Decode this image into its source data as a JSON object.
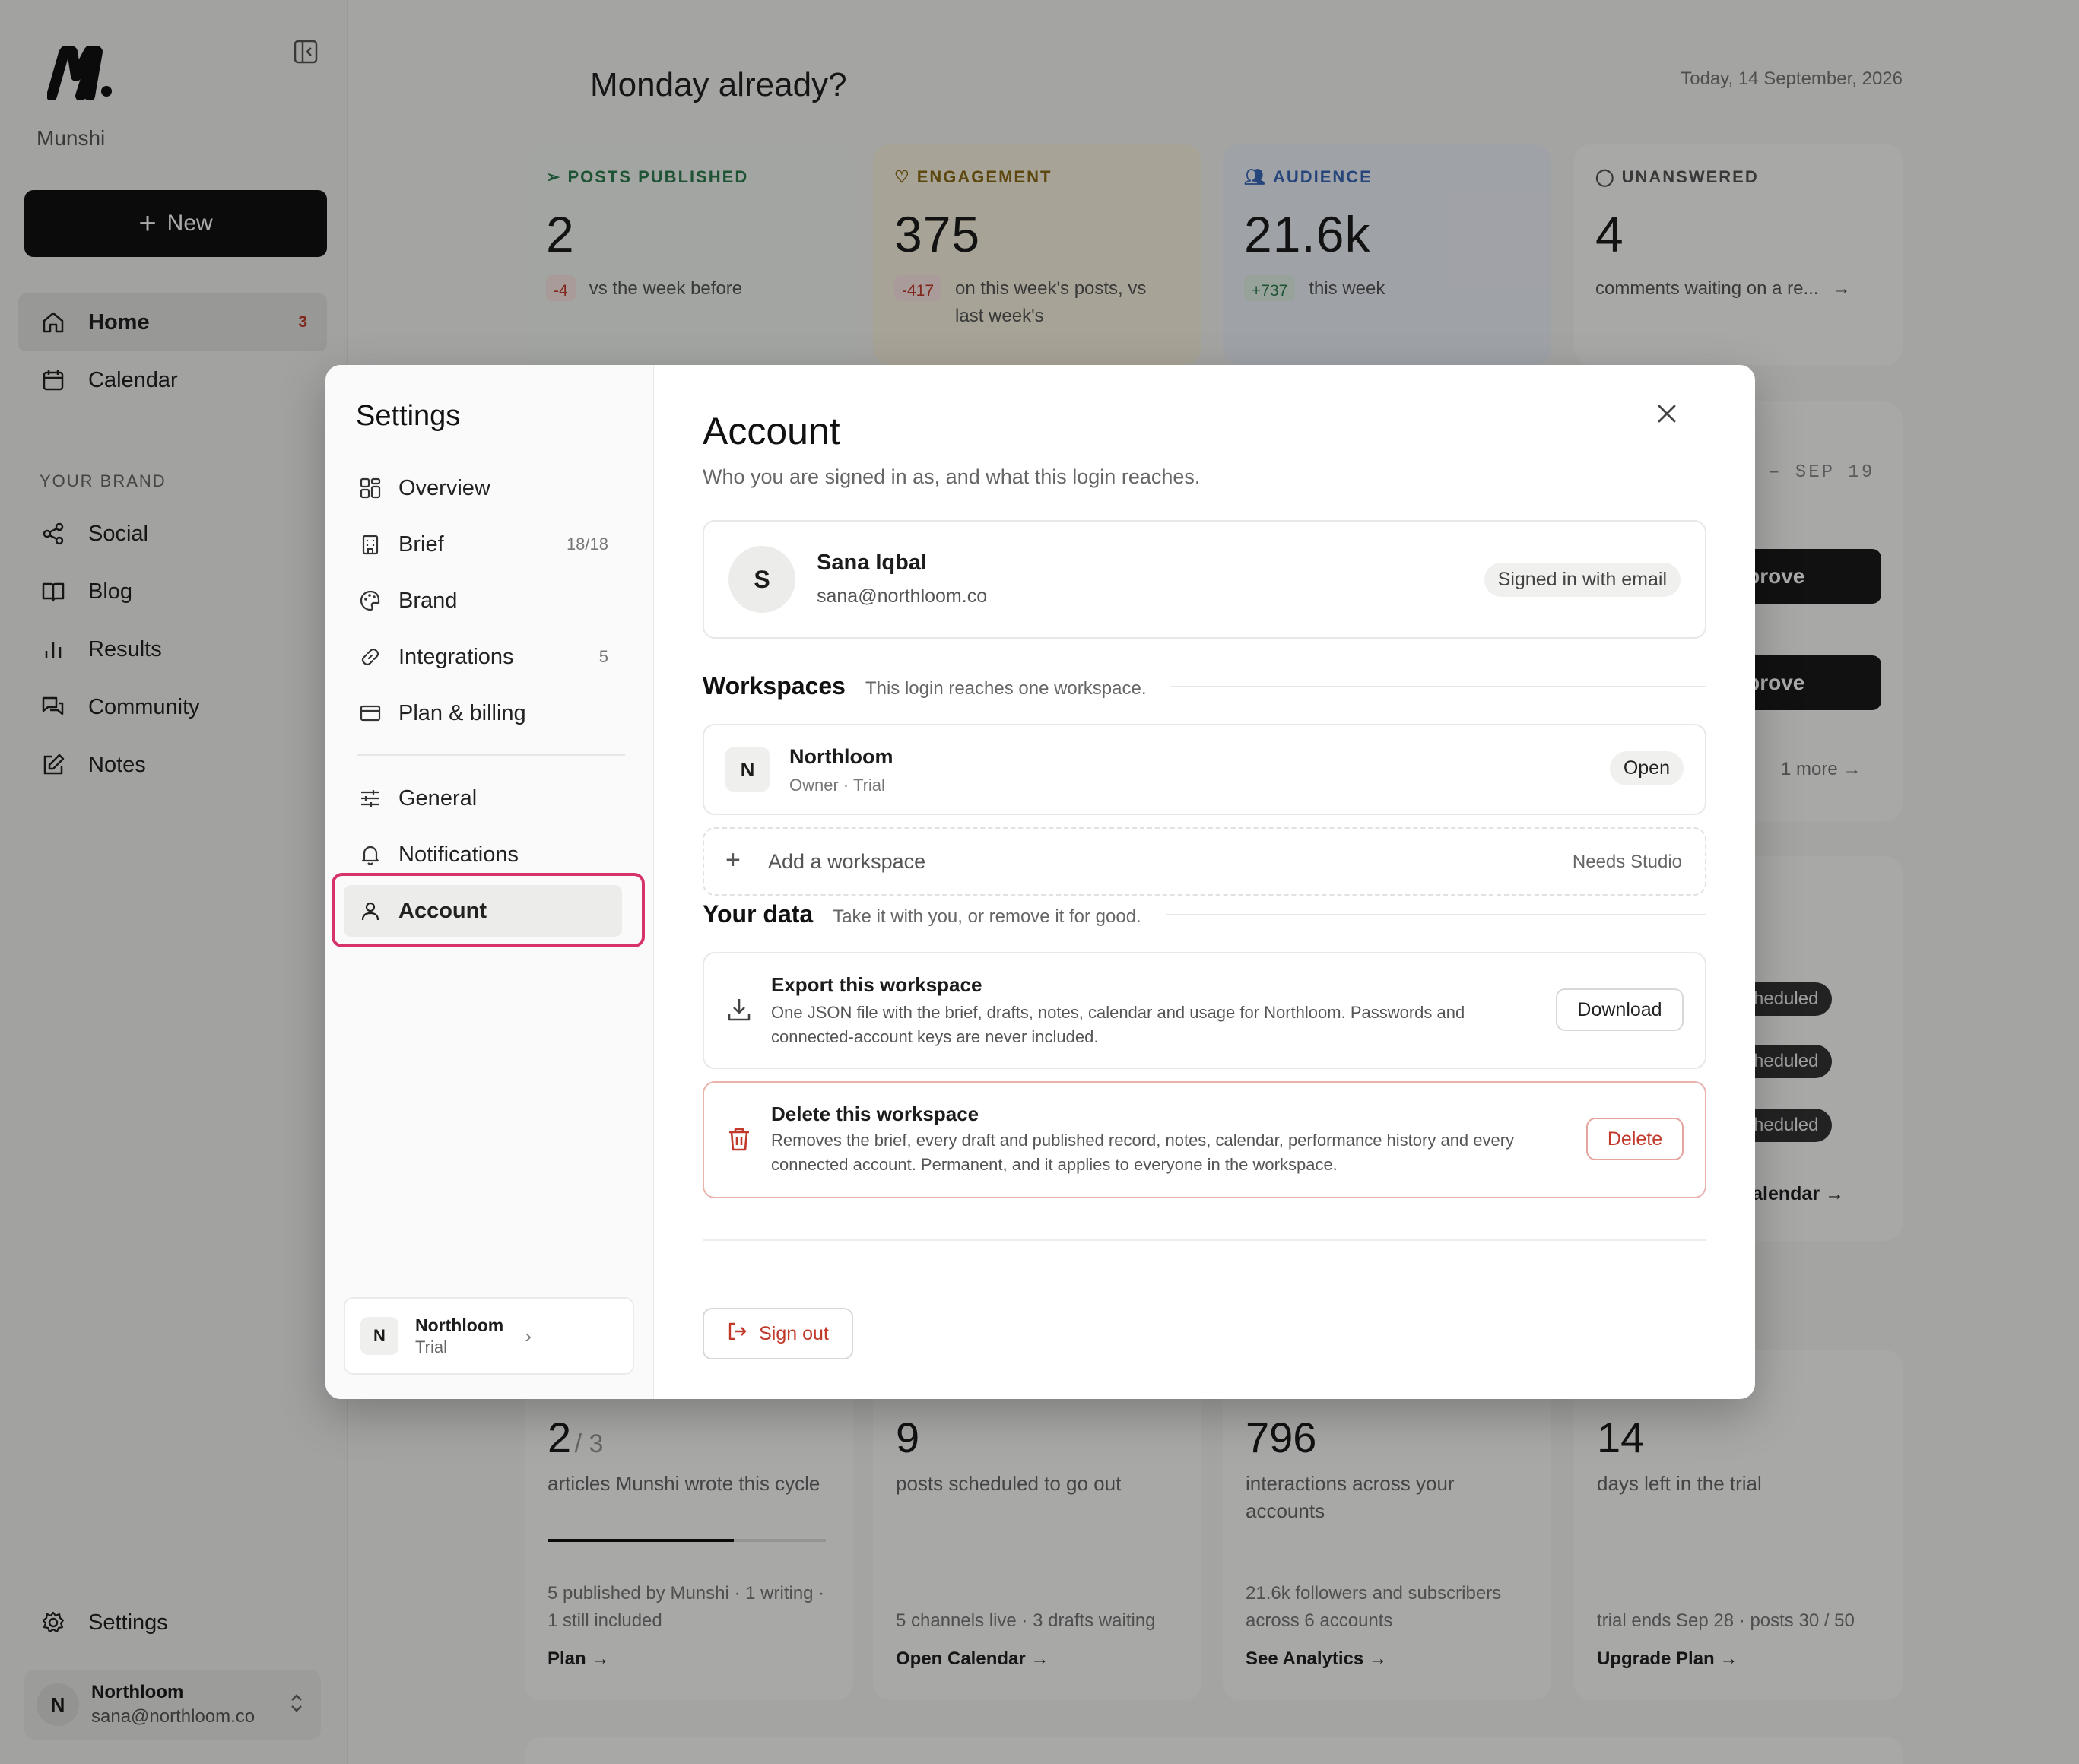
{
  "sidebar": {
    "brand": "Munshi",
    "new_label": "New",
    "nav": [
      {
        "label": "Home",
        "badge": "3",
        "icon": "home-icon"
      },
      {
        "label": "Calendar",
        "icon": "calendar-icon"
      }
    ],
    "section_label": "YOUR BRAND",
    "brand_nav": [
      {
        "label": "Social",
        "icon": "share-icon"
      },
      {
        "label": "Blog",
        "icon": "book-icon"
      },
      {
        "label": "Results",
        "icon": "bar-chart-icon"
      },
      {
        "label": "Community",
        "icon": "chat-icon"
      },
      {
        "label": "Notes",
        "icon": "edit-icon"
      }
    ],
    "settings_label": "Settings",
    "user": {
      "initial": "N",
      "name": "Northloom",
      "email": "sana@northloom.co"
    }
  },
  "main": {
    "greeting": "Monday already?",
    "date": "Today, 14 September, 2026",
    "stats": [
      {
        "label": "POSTS PUBLISHED",
        "value": "2",
        "delta": "-4",
        "sub": "vs the week before",
        "color": "#2f7d4f"
      },
      {
        "label": "ENGAGEMENT",
        "value": "375",
        "delta": "-417",
        "sub": "on this week's posts, vs last week's",
        "color": "#8a6a15"
      },
      {
        "label": "AUDIENCE",
        "value": "21.6k",
        "delta": "+737",
        "sub": "this week",
        "color": "#3a68b8"
      },
      {
        "label": "UNANSWERED",
        "value": "4",
        "sub": "comments waiting on a re...",
        "color": "#555555"
      }
    ],
    "week_range": "– SEP 19",
    "approve_label": "pprove",
    "more_label": "1 more",
    "scheduled_label": "Scheduled",
    "calendar_link": "n calendar →",
    "bottom": [
      {
        "value": "2",
        "value_suffix": "/ 3",
        "desc": "articles Munshi wrote this cycle",
        "progress": 0.67,
        "foot": "5 published by Munshi · 1 writing · 1 still included",
        "link": "Plan →"
      },
      {
        "value": "9",
        "desc": "posts scheduled to go out",
        "foot": "5 channels live · 3 drafts waiting",
        "link": "Open Calendar →"
      },
      {
        "value": "796",
        "desc": "interactions across your accounts",
        "foot": "21.6k followers and subscribers across 6 accounts",
        "link": "See Analytics →"
      },
      {
        "value": "14",
        "desc": "days left in the trial",
        "foot": "trial ends Sep 28 · posts 30 / 50",
        "link": "Upgrade Plan →"
      }
    ]
  },
  "modal": {
    "title": "Settings",
    "menu": [
      {
        "label": "Overview",
        "icon": "grid-icon"
      },
      {
        "label": "Brief",
        "count": "18/18",
        "icon": "building-icon"
      },
      {
        "label": "Brand",
        "icon": "palette-icon"
      },
      {
        "label": "Integrations",
        "count": "5",
        "icon": "link-icon"
      },
      {
        "label": "Plan & billing",
        "icon": "card-icon"
      }
    ],
    "menu2": [
      {
        "label": "General",
        "icon": "sliders-icon"
      },
      {
        "label": "Notifications",
        "icon": "bell-icon"
      },
      {
        "label": "Account",
        "icon": "user-icon"
      }
    ],
    "workspace_chip": {
      "initial": "N",
      "name": "Northloom",
      "plan": "Trial"
    },
    "account": {
      "title": "Account",
      "subtitle": "Who you are signed in as, and what this login reaches.",
      "user": {
        "initial": "S",
        "name": "Sana Iqbal",
        "email": "sana@northloom.co",
        "signin": "Signed in with email"
      },
      "workspaces_title": "Workspaces",
      "workspaces_sub": "This login reaches one workspace.",
      "workspace": {
        "initial": "N",
        "name": "Northloom",
        "meta": "Owner · Trial",
        "open": "Open"
      },
      "add_workspace": "Add a workspace",
      "needs_studio": "Needs Studio",
      "data_title": "Your data",
      "data_sub": "Take it with you, or remove it for good.",
      "export_title": "Export this workspace",
      "export_desc": "One JSON file with the brief, drafts, notes, calendar and usage for Northloom. Passwords and connected-account keys are never included.",
      "download": "Download",
      "delete_title": "Delete this workspace",
      "delete_desc": "Removes the brief, every draft and published record, notes, calendar, performance history and every connected account. Permanent, and it applies to everyone in the workspace.",
      "delete": "Delete",
      "signout": "Sign out"
    }
  },
  "colors": {
    "accent": "#d6336c",
    "danger": "#c0392b",
    "dark": "#111111"
  }
}
